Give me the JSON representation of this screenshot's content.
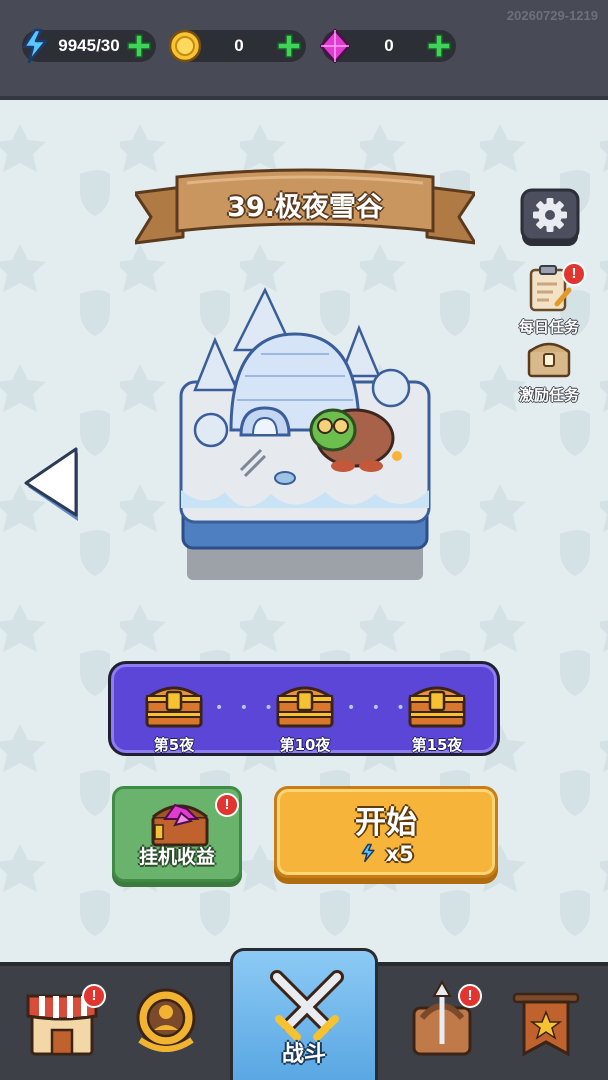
{
  "timestamp": "20260729-1219",
  "resources": {
    "energy": {
      "icon": "lightning-icon",
      "value": "9945/30"
    },
    "gold": {
      "icon": "gold-coin-icon",
      "value": "0"
    },
    "gems": {
      "icon": "purple-gem-icon",
      "value": "0"
    }
  },
  "stage": {
    "title": "39.极夜雪谷"
  },
  "side_tasks": {
    "daily": {
      "label": "每日任务",
      "badge": "!"
    },
    "incentive": {
      "label": "激励任务"
    }
  },
  "rewards": [
    {
      "label": "第5夜"
    },
    {
      "label": "第10夜"
    },
    {
      "label": "第15夜"
    }
  ],
  "idle": {
    "label": "挂机收益",
    "badge": "!"
  },
  "start": {
    "label": "开始",
    "cost": "x5"
  },
  "nav": {
    "shop_badge": "!",
    "battle_label": "战斗",
    "weapon_badge": "!"
  },
  "colors": {
    "accent_purple": "#5b46d8",
    "start_orange": "#f6b43a",
    "idle_green": "#6ab36c",
    "nav_active_blue": "#6fb6ec",
    "badge_red": "#e2352f"
  }
}
